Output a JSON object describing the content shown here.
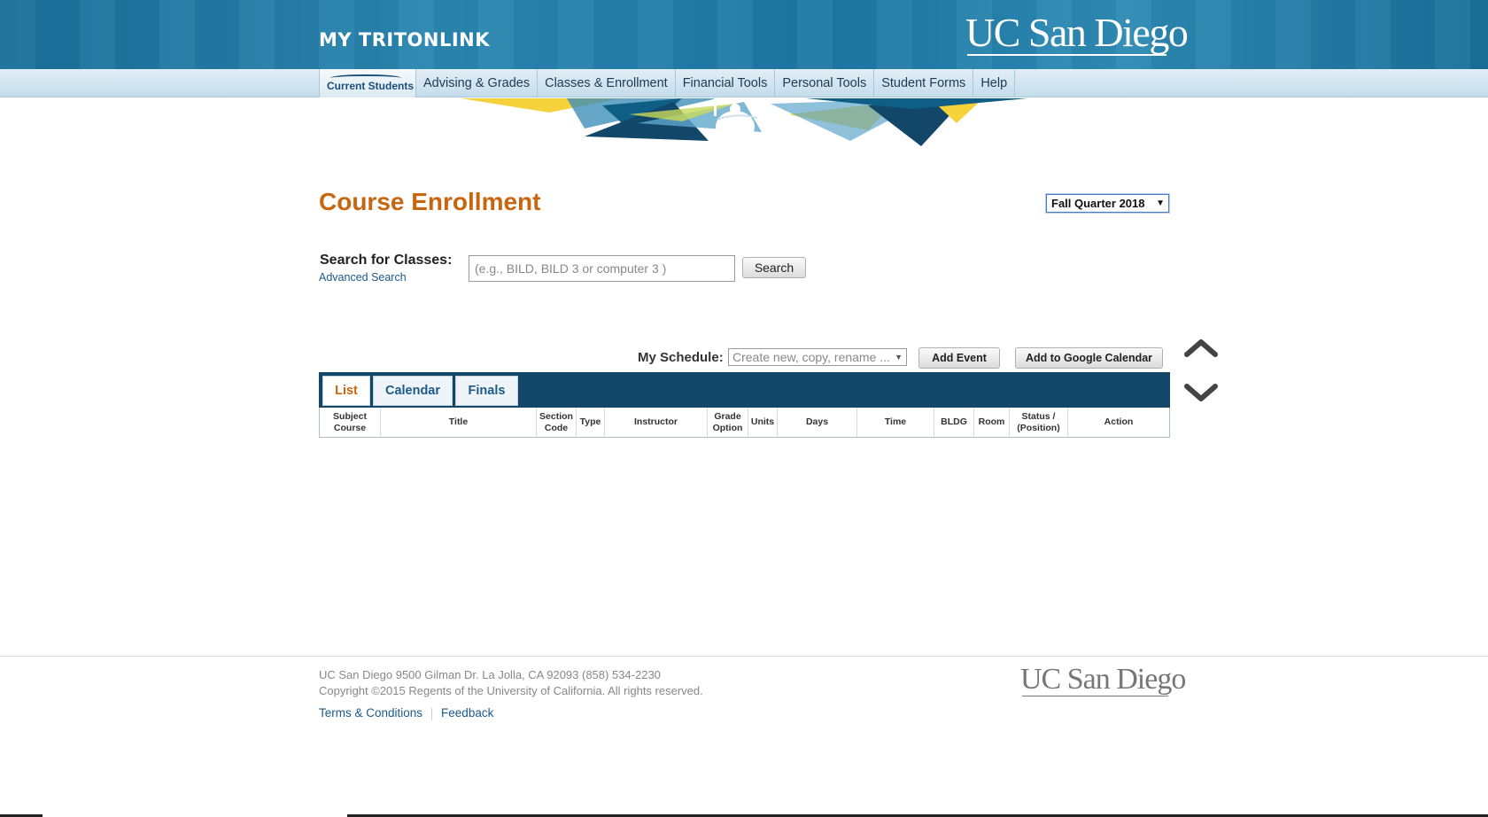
{
  "header": {
    "brand": "MY TRITONLINK",
    "logo": "UC San Diego"
  },
  "nav": {
    "current": "Current Students",
    "items": [
      "Advising & Grades",
      "Classes & Enrollment",
      "Financial Tools",
      "Personal Tools",
      "Student Forms",
      "Help"
    ]
  },
  "main": {
    "title": "Course Enrollment",
    "term": "Fall Quarter 2018",
    "search_label": "Search for Classes:",
    "advanced_search": "Advanced Search",
    "search_placeholder": "(e.g., BILD, BILD 3 or computer 3 )",
    "search_button": "Search",
    "schedule_label": "My Schedule:",
    "schedule_placeholder": "Create new, copy, rename ...",
    "add_event": "Add Event",
    "add_google": "Add to Google Calendar"
  },
  "tabs": [
    "List",
    "Calendar",
    "Finals"
  ],
  "table": {
    "headers": [
      {
        "l1": "Subject",
        "l2": "Course"
      },
      {
        "l1": "Title",
        "l2": ""
      },
      {
        "l1": "Section",
        "l2": "Code"
      },
      {
        "l1": "Type",
        "l2": ""
      },
      {
        "l1": "Instructor",
        "l2": ""
      },
      {
        "l1": "Grade",
        "l2": "Option"
      },
      {
        "l1": "Units",
        "l2": ""
      },
      {
        "l1": "Days",
        "l2": ""
      },
      {
        "l1": "Time",
        "l2": ""
      },
      {
        "l1": "BLDG",
        "l2": ""
      },
      {
        "l1": "Room",
        "l2": ""
      },
      {
        "l1": "Status /",
        "l2": "(Position)"
      },
      {
        "l1": "Action",
        "l2": ""
      }
    ]
  },
  "footer": {
    "address": "UC San Diego 9500 Gilman Dr. La Jolla, CA 92093 (858) 534-2230",
    "copyright": "Copyright ©2015 Regents of the University of California. All rights reserved.",
    "terms": "Terms & Conditions",
    "feedback": "Feedback",
    "logo": "UC San Diego"
  },
  "colors": {
    "header_blue": "#1d78a3",
    "title_orange": "#c8660f",
    "tabbar_navy": "#13476a",
    "link_blue": "#1a5a8c",
    "banner_gold": "#f5d13a"
  },
  "icons": [
    "chevron-up-icon",
    "chevron-down-icon",
    "triton-statue-icon"
  ]
}
